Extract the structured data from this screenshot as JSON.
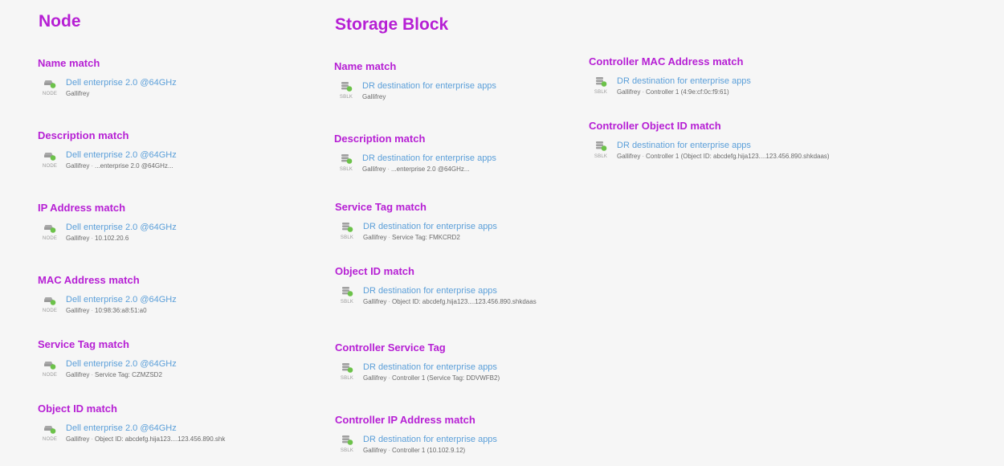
{
  "colors": {
    "heading": "#b61fd4",
    "link": "#5b9fd9",
    "meta": "#6a6a6a",
    "status_dot": "#6cc24a"
  },
  "icons": {
    "node": "node-icon",
    "storage_block": "storage-block-icon"
  },
  "separator": "·",
  "node": {
    "title": "Node",
    "icon_label": "NODE",
    "groups": [
      {
        "title": "Name match",
        "link": "Dell enterprise 2.0 @64GHz",
        "location": "Gallifrey",
        "detail": ""
      },
      {
        "title": "Description match",
        "link": "Dell enterprise 2.0 @64GHz",
        "location": "Gallifrey",
        "detail": "...enterprise 2.0 @64GHz..."
      },
      {
        "title": "IP Address match",
        "link": "Dell enterprise 2.0 @64GHz",
        "location": "Gallifrey",
        "detail": "10.102.20.6"
      },
      {
        "title": "MAC Address match",
        "link": "Dell enterprise 2.0 @64GHz",
        "location": "Gallifrey",
        "detail": "10:98:36:a8:51:a0"
      },
      {
        "title": "Service Tag match",
        "link": "Dell enterprise 2.0 @64GHz",
        "location": "Gallifrey",
        "detail": "Service Tag: CZMZSD2"
      },
      {
        "title": "Object ID match",
        "link": "Dell enterprise 2.0 @64GHz",
        "location": "Gallifrey",
        "detail": "Object ID: abcdefg.hija123....123.456.890.shk"
      }
    ]
  },
  "storage_block": {
    "title": "Storage Block",
    "icon_label": "SBLK",
    "groups": [
      {
        "title": "Name match",
        "link": "DR destination for enterprise apps",
        "location": "Gallifrey",
        "detail": ""
      },
      {
        "title": "Description match",
        "link": "DR destination for enterprise apps",
        "location": "Gallifrey",
        "detail": "...enterprise 2.0 @64GHz..."
      },
      {
        "title": "Service Tag match",
        "link": "DR destination for enterprise apps",
        "location": "Gallifrey",
        "detail": "Service Tag: FMKCRD2"
      },
      {
        "title": "Object ID match",
        "link": "DR destination for enterprise apps",
        "location": "Gallifrey",
        "detail": "Object ID: abcdefg.hija123....123.456.890.shkdaas"
      },
      {
        "title": "Controller Service Tag",
        "link": "DR destination for enterprise apps",
        "location": "Gallifrey",
        "detail": "Controller 1 (Service Tag: DDVWFB2)"
      },
      {
        "title": "Controller IP Address match",
        "link": "DR destination for enterprise apps",
        "location": "Gallifrey",
        "detail": "Controller 1 (10.102.9.12)"
      },
      {
        "title": "Controller MAC Address match",
        "link": "DR destination for enterprise apps",
        "location": "Gallifrey",
        "detail": "Controller 1 (4:9e:cf:0c:f9:61)"
      },
      {
        "title": "Controller Object ID match",
        "link": "DR destination for enterprise apps",
        "location": "Gallifrey",
        "detail": "Controller 1 (Object ID: abcdefg.hija123....123.456.890.shkdaas)"
      }
    ]
  }
}
